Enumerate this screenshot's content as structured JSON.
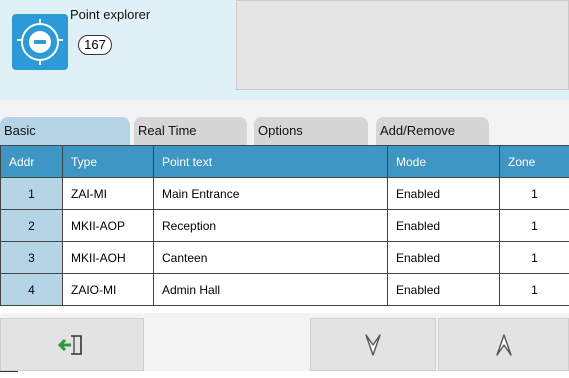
{
  "header": {
    "title": "Point explorer",
    "point_count": "167",
    "icon": "device-logo-icon",
    "accent_color": "#2a9ad8"
  },
  "tabs": [
    {
      "label": "Basic",
      "active": true
    },
    {
      "label": "Real Time",
      "active": false
    },
    {
      "label": "Options",
      "active": false
    },
    {
      "label": "Add/Remove",
      "active": false
    }
  ],
  "table": {
    "columns": [
      "Addr",
      "Type",
      "Point text",
      "Mode",
      "Zone"
    ],
    "rows": [
      {
        "addr": "1",
        "type": "ZAI-MI",
        "point_text": "Main Entrance",
        "mode": "Enabled",
        "zone": "1"
      },
      {
        "addr": "2",
        "type": "MKII-AOP",
        "point_text": "Reception",
        "mode": "Enabled",
        "zone": "1"
      },
      {
        "addr": "3",
        "type": "MKII-AOH",
        "point_text": "Canteen",
        "mode": "Enabled",
        "zone": "1"
      },
      {
        "addr": "4",
        "type": "ZAIO-MI",
        "point_text": "Admin Hall",
        "mode": "Enabled",
        "zone": "1"
      }
    ],
    "header_color": "#3e96c4",
    "addr_color": "#b5d5e7"
  },
  "footer": {
    "buttons": [
      {
        "icon": "exit-icon",
        "accent": "#2e9a3a"
      },
      {
        "icon": "scroll-down-icon"
      },
      {
        "icon": "scroll-up-icon"
      }
    ]
  }
}
